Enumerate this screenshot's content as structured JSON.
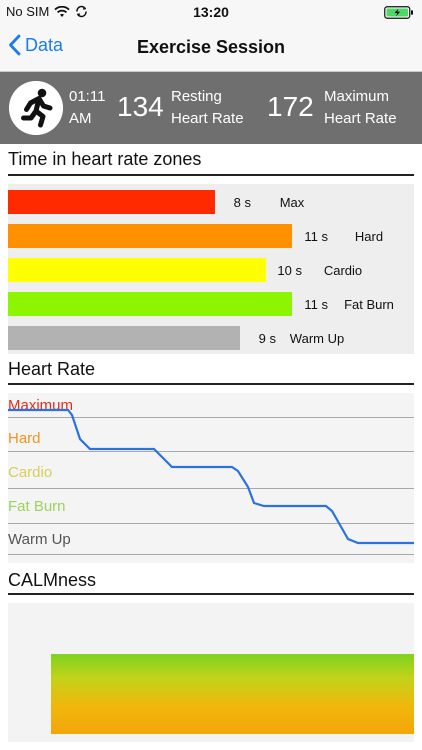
{
  "status_bar": {
    "carrier": "No SIM",
    "time": "13:20"
  },
  "nav": {
    "back_label": "Data",
    "title": "Exercise Session"
  },
  "summary": {
    "start_time": "01:11 AM",
    "resting_hr": "134",
    "resting_label": "Resting Heart Rate",
    "max_hr": "172",
    "max_label": "Maximum Heart Rate"
  },
  "zones": {
    "title": "Time in heart rate zones",
    "items": [
      {
        "name": "Max",
        "duration": "8 s",
        "seconds": 8,
        "color": "#ff2a00"
      },
      {
        "name": "Hard",
        "duration": "11 s",
        "seconds": 11,
        "color": "#ff9000"
      },
      {
        "name": "Cardio",
        "duration": "10 s",
        "seconds": 10,
        "color": "#ffff00"
      },
      {
        "name": "Fat Burn",
        "duration": "11 s",
        "seconds": 11,
        "color": "#8ef500"
      },
      {
        "name": "Warm Up",
        "duration": "9 s",
        "seconds": 9,
        "color": "#b2b2b2"
      }
    ]
  },
  "heart_rate": {
    "title": "Heart Rate",
    "zone_labels": [
      {
        "name": "Maximum",
        "color": "#e03018"
      },
      {
        "name": "Hard",
        "color": "#f0941e"
      },
      {
        "name": "Cardio",
        "color": "#d8cf55"
      },
      {
        "name": "Fat Burn",
        "color": "#9ad45a"
      },
      {
        "name": "Warm Up",
        "color": "#555555"
      }
    ],
    "line_color": "#2a72e0"
  },
  "calmness": {
    "title": "CALMness"
  }
}
